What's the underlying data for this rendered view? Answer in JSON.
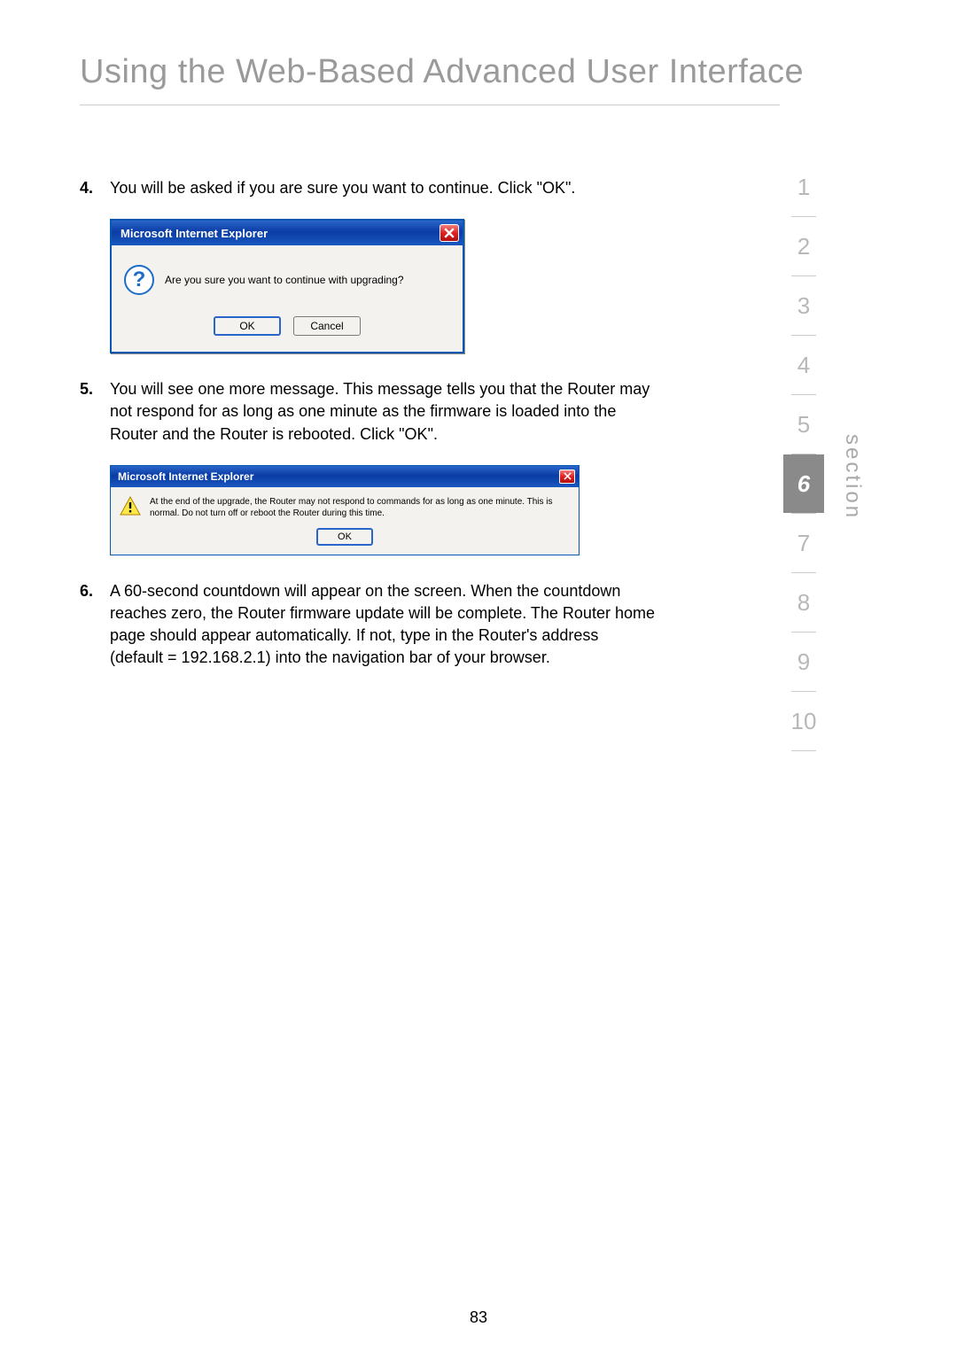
{
  "title": "Using the Web-Based Advanced User Interface",
  "steps": {
    "s4": {
      "num": "4.",
      "text": "You will be asked if you are sure you want to continue. Click \"OK\"."
    },
    "s5": {
      "num": "5.",
      "text": "You will see one more message. This message tells you that the Router may not respond for as long as one minute as the firmware is loaded into the Router and the Router is rebooted. Click \"OK\"."
    },
    "s6": {
      "num": "6.",
      "text": "A 60-second countdown will appear on the screen. When the countdown reaches zero, the Router firmware update will be complete. The Router home page should appear automatically. If not, type in the Router's address (default = 192.168.2.1) into the navigation bar of your browser."
    }
  },
  "dialog1": {
    "title": "Microsoft Internet Explorer",
    "message": "Are you sure you want to continue with upgrading?",
    "ok": "OK",
    "cancel": "Cancel"
  },
  "dialog2": {
    "title": "Microsoft Internet Explorer",
    "message": "At the end of the upgrade, the Router may not respond to commands for as long as one minute. This is normal. Do not turn off or reboot the Router during this time.",
    "ok": "OK"
  },
  "sidebar": {
    "items": [
      "1",
      "2",
      "3",
      "4",
      "5",
      "6",
      "7",
      "8",
      "9",
      "10"
    ],
    "active": "6",
    "label": "section"
  },
  "pageNum": "83"
}
